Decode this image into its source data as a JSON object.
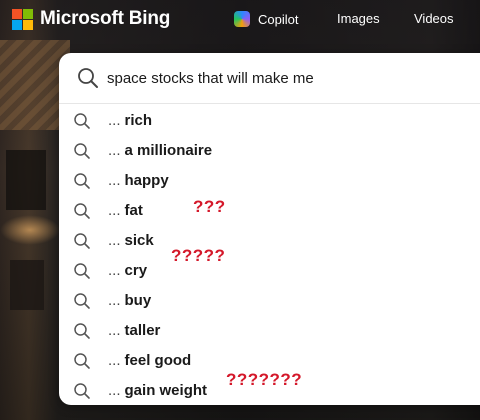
{
  "header": {
    "brand": "Microsoft Bing",
    "logo_colors": [
      "#f35325",
      "#81bc06",
      "#05a6f0",
      "#ffba08"
    ],
    "nav": [
      {
        "label": "Copilot",
        "icon": "copilot-icon"
      },
      {
        "label": "Images"
      },
      {
        "label": "Videos"
      }
    ]
  },
  "search": {
    "value": "space stocks that will make me",
    "icon": "search-icon"
  },
  "suggestions": [
    {
      "prefix": "...",
      "completion": "rich"
    },
    {
      "prefix": "...",
      "completion": "a millionaire"
    },
    {
      "prefix": "...",
      "completion": "happy"
    },
    {
      "prefix": "...",
      "completion": "fat"
    },
    {
      "prefix": "...",
      "completion": "sick"
    },
    {
      "prefix": "...",
      "completion": "cry"
    },
    {
      "prefix": "...",
      "completion": "buy"
    },
    {
      "prefix": "...",
      "completion": "taller"
    },
    {
      "prefix": "...",
      "completion": "feel good"
    },
    {
      "prefix": "...",
      "completion": "gain weight"
    }
  ],
  "annotations": [
    {
      "text": "???",
      "color": "#d4182a"
    },
    {
      "text": "?????",
      "color": "#d4182a"
    },
    {
      "text": "???????",
      "color": "#d4182a"
    }
  ]
}
